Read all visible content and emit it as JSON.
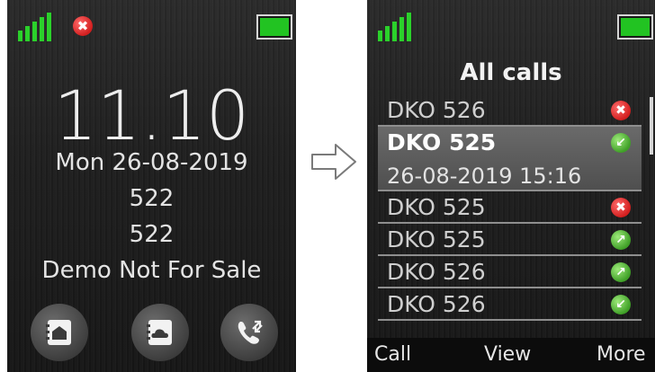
{
  "left_screen": {
    "time": "11.10",
    "date": "Mon 26-08-2019",
    "extension_1": "522",
    "extension_2": "522",
    "banner": "Demo Not For Sale",
    "status_error_glyph": "✖",
    "icons": [
      "phonebook-icon",
      "cloud-contacts-icon",
      "call-log-icon"
    ]
  },
  "right_screen": {
    "title": "All calls",
    "calls": [
      {
        "name": "DKO 526",
        "status": "missed",
        "glyph": "✖"
      },
      {
        "name": "DKO 525",
        "status": "incoming",
        "glyph": "↙",
        "datetime": "26-08-2019 15:16"
      },
      {
        "name": "DKO 525",
        "status": "missed",
        "glyph": "✖"
      },
      {
        "name": "DKO 525",
        "status": "outgoing",
        "glyph": "↗"
      },
      {
        "name": "DKO 526",
        "status": "outgoing",
        "glyph": "↗"
      },
      {
        "name": "DKO 526",
        "status": "incoming",
        "glyph": "↙"
      }
    ],
    "softkeys": {
      "left": "Call",
      "middle": "View",
      "right": "More"
    }
  },
  "colors": {
    "signal": "#2bd12b",
    "battery": "#22c322",
    "missed": "#d21f1f",
    "answered": "#3f9f27"
  }
}
